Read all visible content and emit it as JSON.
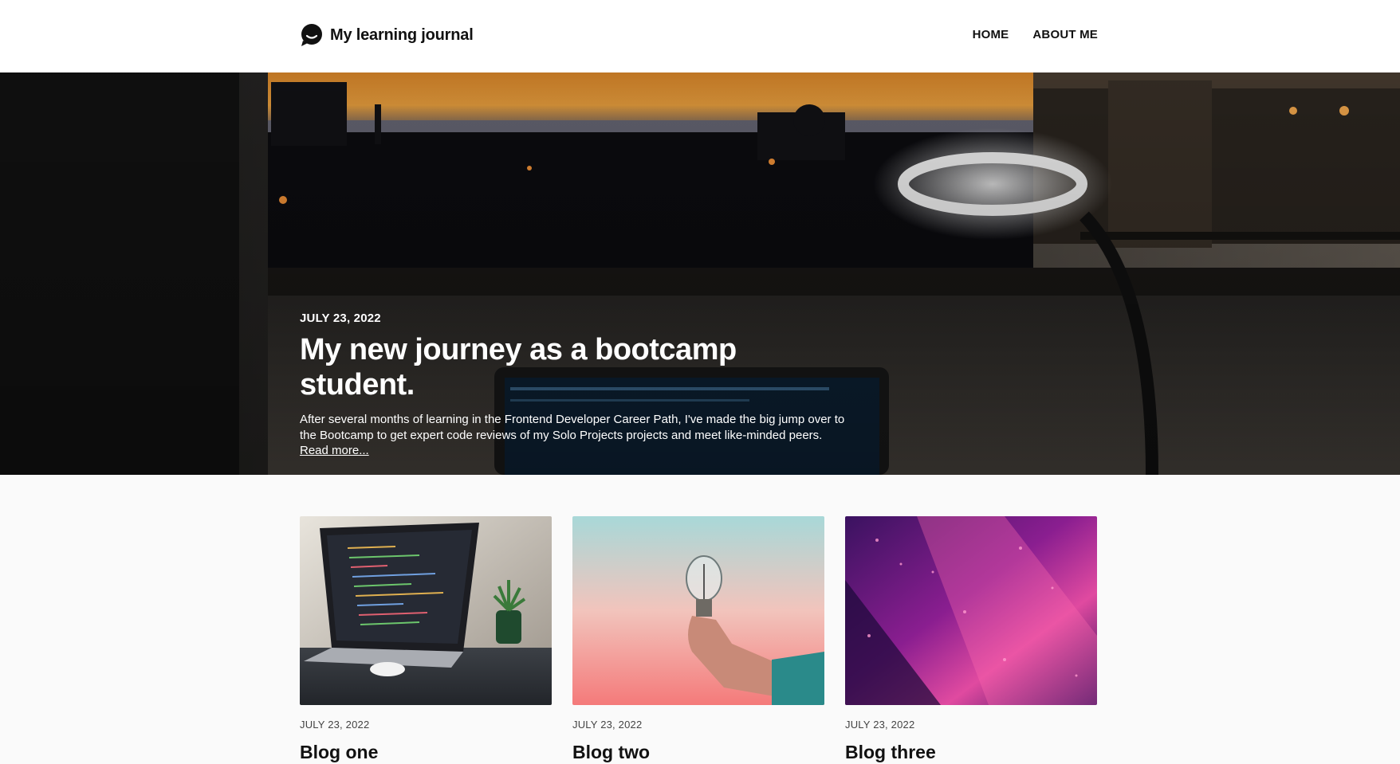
{
  "header": {
    "logo_text": "My learning journal",
    "nav": [
      "HOME",
      "ABOUT ME"
    ]
  },
  "hero": {
    "date": "JULY 23, 2022",
    "title": "My new journey as a bootcamp student.",
    "text": "After several months of learning in the Frontend Developer Career Path, I've made the big jump over to the Bootcamp to get expert code reviews of my Solo Projects projects and meet like-minded peers.",
    "link": "Read more..."
  },
  "posts": [
    {
      "date": "JULY 23, 2022",
      "title": "Blog one"
    },
    {
      "date": "JULY 23, 2022",
      "title": "Blog two"
    },
    {
      "date": "JULY 23, 2022",
      "title": "Blog three"
    }
  ],
  "colors": {
    "header_bg": "#ffffff",
    "page_bg": "#fafafa",
    "text": "#111111",
    "hero_text": "#ffffff"
  }
}
